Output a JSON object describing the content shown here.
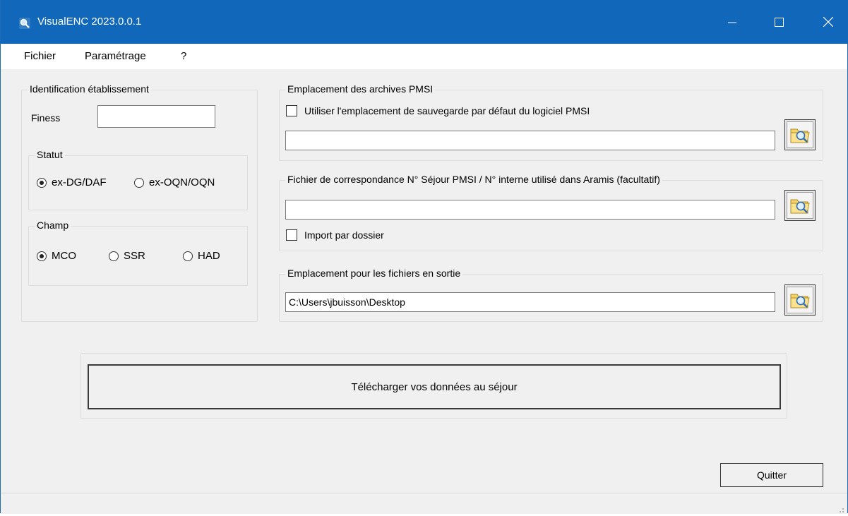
{
  "window": {
    "title": "VisualENC 2023.0.0.1"
  },
  "icons": {
    "app": "app-magnifier-icon",
    "minimize": "minimize-icon",
    "maximize": "maximize-icon",
    "close": "close-icon",
    "browse": "folder-search-icon"
  },
  "colors": {
    "titlebar": "#1167b9",
    "window_bg": "#f0f0f0"
  },
  "menu": {
    "items": [
      "Fichier",
      "Paramétrage",
      "?"
    ]
  },
  "identification": {
    "legend": "Identification établissement",
    "finess_label": "Finess",
    "finess_value": "",
    "statut": {
      "legend": "Statut",
      "options": [
        "ex-DG/DAF",
        "ex-OQN/OQN"
      ],
      "selected": "ex-DG/DAF"
    },
    "champ": {
      "legend": "Champ",
      "options": [
        "MCO",
        "SSR",
        "HAD"
      ],
      "selected": "MCO"
    }
  },
  "archives": {
    "legend": "Emplacement des archives PMSI",
    "checkbox_label": "Utiliser l'emplacement de sauvegarde par défaut du logiciel PMSI",
    "checked": false,
    "path_value": ""
  },
  "correspondance": {
    "legend": "Fichier de correspondance N° Séjour PMSI / N° interne utilisé dans Aramis (facultatif)",
    "path_value": "",
    "checkbox_label": "Import par dossier",
    "checked": false
  },
  "output": {
    "legend": "Emplacement pour les fichiers en sortie",
    "path_value": "C:\\Users\\jbuisson\\Desktop"
  },
  "actions": {
    "download_label": "Télécharger vos données au séjour",
    "quit_label": "Quitter"
  }
}
